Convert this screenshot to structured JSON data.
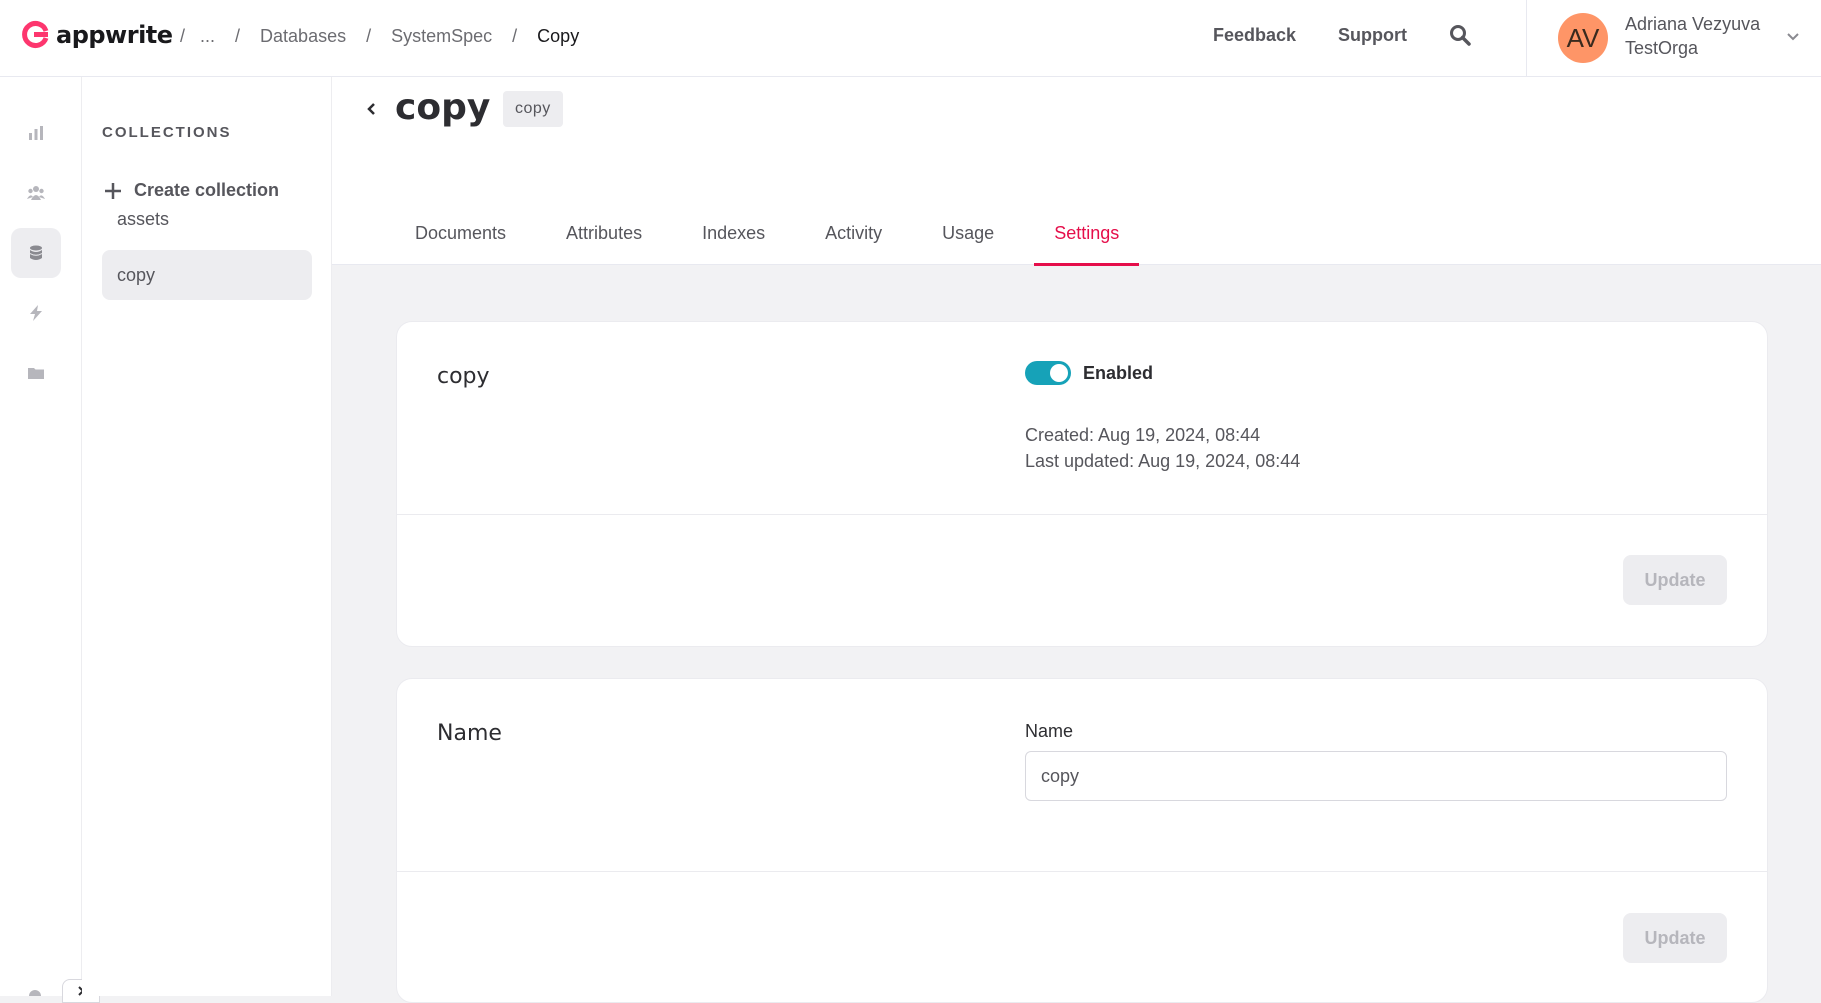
{
  "header": {
    "logo_text": "appwrite",
    "breadcrumb": [
      "...",
      "Databases",
      "SystemSpec",
      "Copy"
    ],
    "links": [
      "Feedback",
      "Support"
    ],
    "search_icon": "search-icon",
    "user": {
      "initials": "AV",
      "name": "Adriana Vezyuva",
      "org": "TestOrga",
      "avatar_color": "#fe9567"
    }
  },
  "rail": {
    "items": [
      "overview-icon",
      "auth-icon",
      "databases-icon",
      "functions-icon",
      "storage-icon"
    ],
    "active_index": 2
  },
  "collections": {
    "title": "COLLECTIONS",
    "create_label": "Create collection",
    "items": [
      "assets",
      "copy"
    ],
    "active_index": 1
  },
  "page": {
    "title": "copy",
    "id_tag": "copy",
    "tabs": [
      "Documents",
      "Attributes",
      "Indexes",
      "Activity",
      "Usage",
      "Settings"
    ],
    "active_tab": 5
  },
  "status_card": {
    "title": "copy",
    "toggle_label": "Enabled",
    "toggle_on": true,
    "created": "Created: Aug 19, 2024, 08:44",
    "updated": "Last updated: Aug 19, 2024, 08:44",
    "button": "Update"
  },
  "name_card": {
    "title": "Name",
    "field_label": "Name",
    "field_value": "copy",
    "button": "Update"
  },
  "colors": {
    "accent": "#e50e4a",
    "toggle": "#16a2b8"
  }
}
